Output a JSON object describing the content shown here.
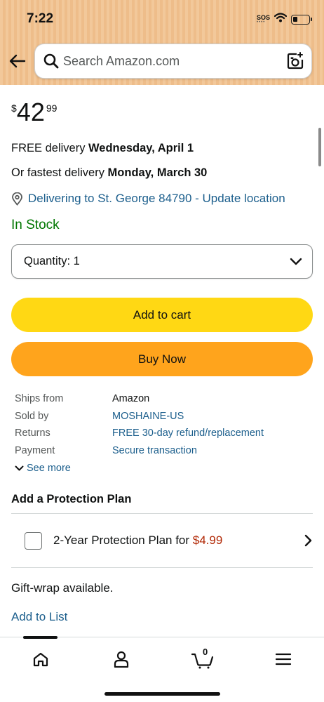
{
  "status_bar": {
    "time": "7:22",
    "sos": "SOS"
  },
  "search": {
    "placeholder": "Search Amazon.com"
  },
  "price": {
    "symbol": "$",
    "whole": "42",
    "fraction": "99"
  },
  "delivery": {
    "free_prefix": "FREE delivery ",
    "free_date": "Wednesday, April 1",
    "fast_prefix": "Or fastest delivery ",
    "fast_date": "Monday, March 30",
    "location": "Delivering to St. George 84790 - Update location"
  },
  "stock_status": "In Stock",
  "quantity": {
    "label": "Quantity: ",
    "value": "1"
  },
  "buttons": {
    "add_to_cart": "Add to cart",
    "buy_now": "Buy Now"
  },
  "details": [
    {
      "key": "Ships from",
      "value": "Amazon"
    },
    {
      "key": "Sold by",
      "value": "MOSHAINE-US"
    },
    {
      "key": "Returns",
      "value": "FREE 30-day refund/replacement"
    },
    {
      "key": "Payment",
      "value": "Secure transaction"
    }
  ],
  "see_more": "See more",
  "protection": {
    "title": "Add a Protection Plan",
    "plan_label": "2-Year Protection Plan for ",
    "plan_price": "$4.99"
  },
  "gift_wrap": "Gift-wrap available.",
  "add_to_list": "Add to List",
  "tabbar": {
    "cart_count": "0",
    "active_tab": "home"
  },
  "colors": {
    "link": "#1b5e8c",
    "in_stock": "#007600",
    "add_to_cart": "#ffd814",
    "buy_now": "#ffa41c",
    "price_red": "#b12704"
  },
  "icons": [
    "back-arrow-icon",
    "search-icon",
    "camera-icon",
    "wifi-icon",
    "battery-icon",
    "location-pin-icon",
    "chevron-down-icon",
    "chevron-right-icon",
    "home-icon",
    "account-icon",
    "cart-icon",
    "menu-icon"
  ]
}
